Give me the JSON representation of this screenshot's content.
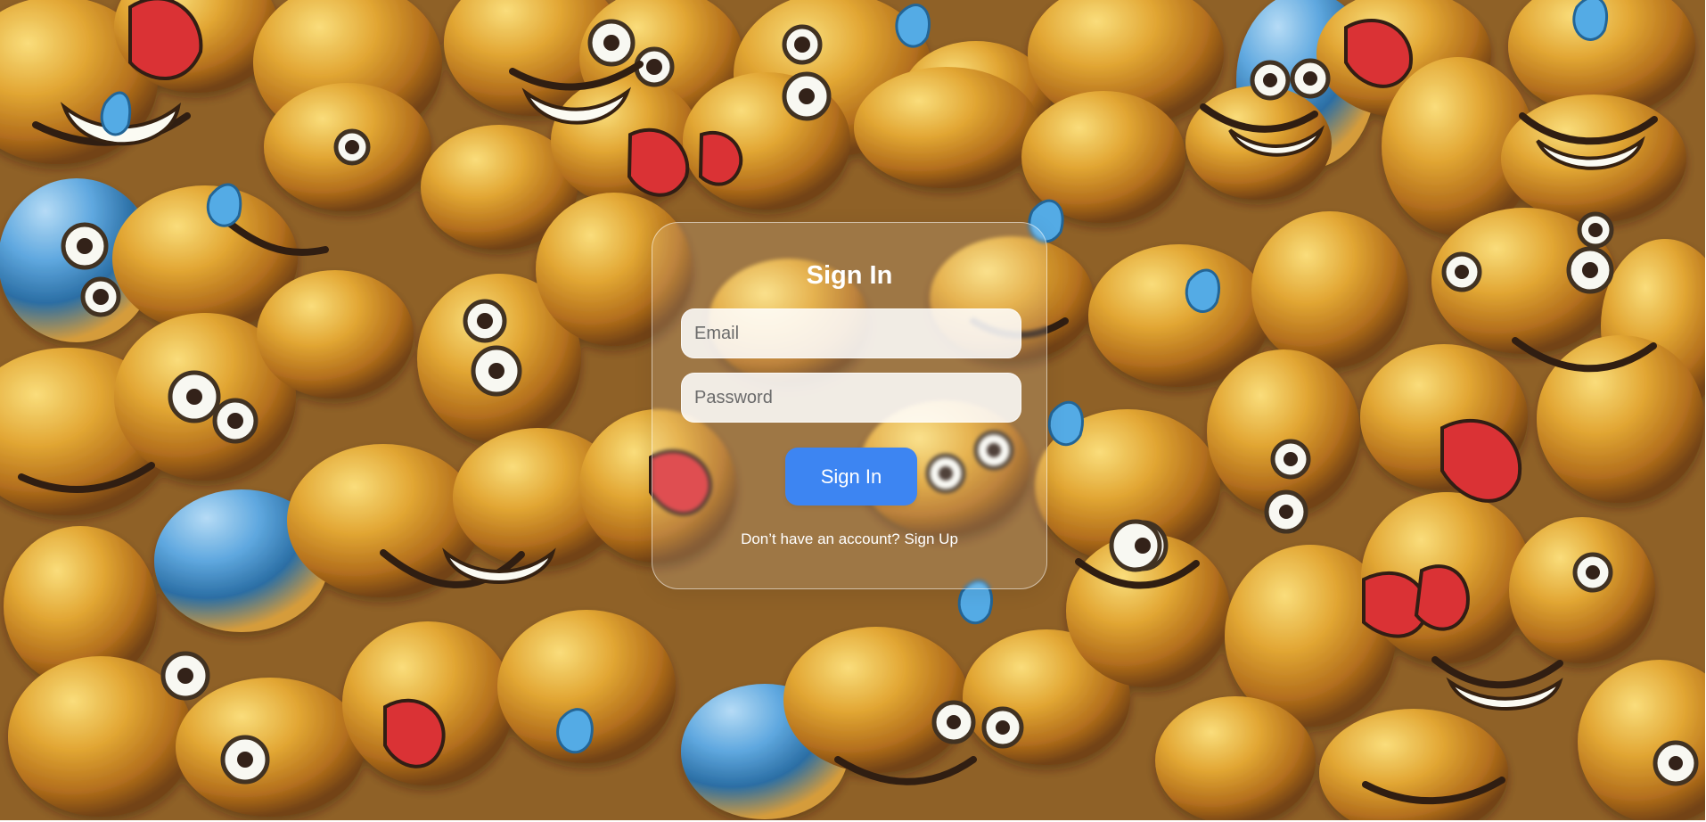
{
  "signin": {
    "title": "Sign In",
    "email_placeholder": "Email",
    "password_placeholder": "Password",
    "submit_label": "Sign In",
    "prompt_text": "Don’t have an account?",
    "signup_label": "Sign Up"
  },
  "colors": {
    "primary_button": "#3d85f2",
    "card_border": "rgba(255,255,255,0.55)",
    "text": "#ffffff"
  },
  "background": {
    "image_description": "emoji-pattern"
  }
}
